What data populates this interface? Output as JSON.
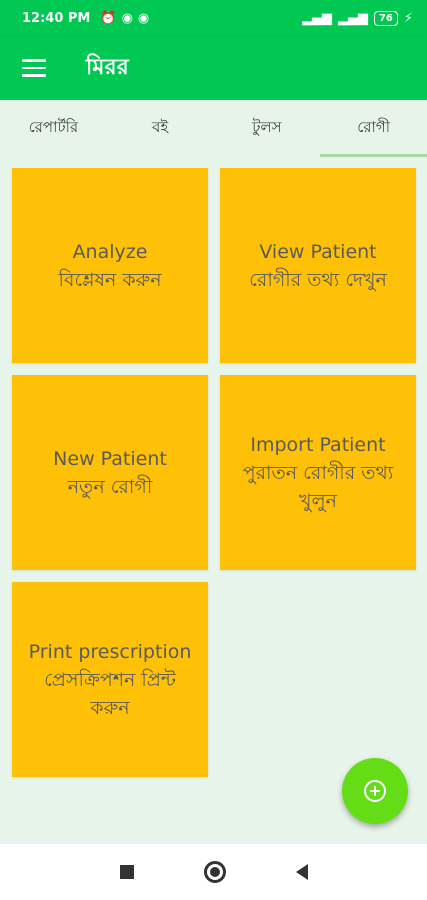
{
  "status_bar": {
    "time": "12:40 PM",
    "battery": "76"
  },
  "app_bar": {
    "title": "মিরর"
  },
  "tabs": [
    {
      "label": "রেপার্টরি",
      "active": false
    },
    {
      "label": "বই",
      "active": false
    },
    {
      "label": "টুলস",
      "active": false
    },
    {
      "label": "রোগী",
      "active": true
    }
  ],
  "cards": [
    {
      "en": "Analyze",
      "bn": "বিশ্লেষন করুন"
    },
    {
      "en": "View Patient",
      "bn": "রোগীর তথ্য দেখুন"
    },
    {
      "en": "New Patient",
      "bn": "নতুন রোগী"
    },
    {
      "en": "Import Patient",
      "bn": "পুরাতন রোগীর তথ্য খুলুন"
    },
    {
      "en": "Print prescription",
      "bn": "প্রেসক্রিপশন প্রিন্ট করুন"
    }
  ],
  "colors": {
    "primary": "#00c853",
    "card": "#ffc107",
    "fab": "#64dd17",
    "background": "#e7f4e9"
  }
}
